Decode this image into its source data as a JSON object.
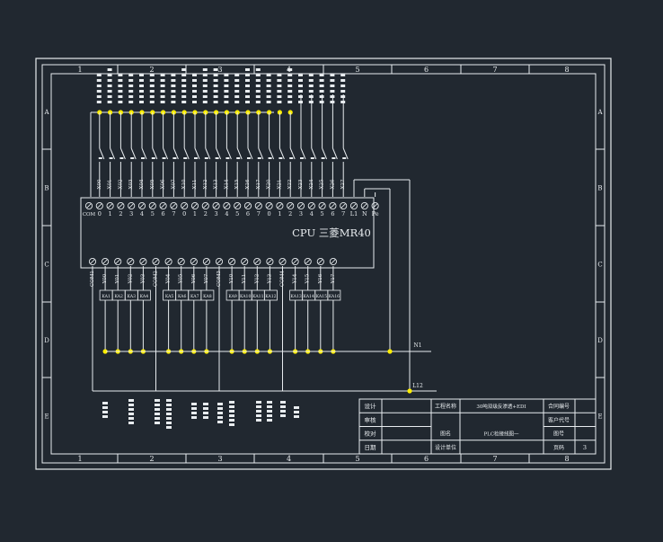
{
  "colors": {
    "background": "#212830",
    "line": "#e8ecef",
    "junction": "#ffee00"
  },
  "frame": {
    "column_labels": [
      "1",
      "2",
      "3",
      "4",
      "5",
      "6",
      "7",
      "8"
    ],
    "row_labels": [
      "A",
      "B",
      "C",
      "D",
      "E"
    ]
  },
  "plc": {
    "label": "CPU 三菱MR40",
    "input_terminals": [
      "COM",
      "0",
      "1",
      "2",
      "3",
      "4",
      "5",
      "6",
      "7",
      "0",
      "1",
      "2",
      "3",
      "4",
      "5",
      "6",
      "7",
      "0",
      "1",
      "2",
      "3",
      "4",
      "5",
      "6",
      "7",
      "L1",
      "N",
      "Pe"
    ],
    "input_addresses": [
      "X00",
      "X01",
      "X02",
      "X03",
      "X04",
      "X05",
      "X06",
      "X07",
      "X10",
      "X11",
      "X12",
      "X13",
      "X14",
      "X15",
      "X16",
      "X17",
      "X20",
      "X21",
      "X22",
      "X23",
      "X24",
      "X25",
      "X26",
      "X27"
    ],
    "output_addresses": [
      "COM1",
      "Y00",
      "Y01",
      "Y02",
      "Y03",
      "COM2",
      "Y04",
      "Y05",
      "Y06",
      "Y07",
      "COM3",
      "Y10",
      "Y11",
      "Y12",
      "Y13",
      "COM4",
      "Y14",
      "Y15",
      "Y16",
      "Y17"
    ],
    "relays": [
      "KA1",
      "KA2",
      "KA3",
      "KA4",
      "KA5",
      "KA6",
      "KA7",
      "KA8",
      "KA9",
      "KA10",
      "KA11",
      "KA12",
      "KA13",
      "KA14",
      "KA15",
      "KA16"
    ],
    "bus_labels": {
      "n": "N1",
      "l": "L12"
    }
  },
  "title_block": {
    "rows": [
      {
        "left": "设计",
        "mid_label": "工程名称",
        "mid_value": "30吨双级反渗透+EDI",
        "right_label": "合同编号",
        "right_value": ""
      },
      {
        "left": "审核",
        "mid_label": "",
        "mid_value": "",
        "right_label": "客户代号",
        "right_value": ""
      },
      {
        "left": "校对",
        "mid_label": "图名",
        "mid_value": "PLC检接线图一",
        "right_label": "图号",
        "right_value": ""
      },
      {
        "left": "日期",
        "mid_label": "设计单位",
        "mid_value": "",
        "right_label": "页码",
        "right_value": "3"
      }
    ]
  }
}
